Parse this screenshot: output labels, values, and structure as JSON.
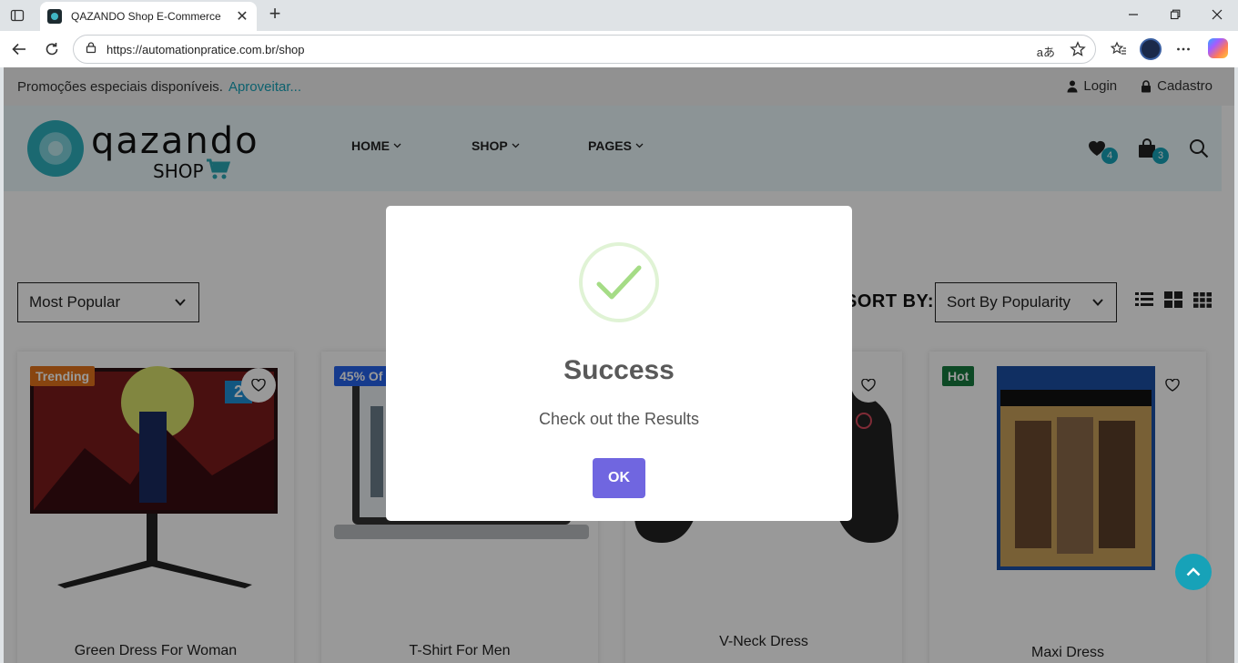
{
  "browser": {
    "tab_title": "QAZANDO Shop E-Commerce",
    "url": "https://automationpratice.com.br/shop",
    "translate_glyph": "aあ"
  },
  "site": {
    "promo_text": "Promoções especiais disponíveis.",
    "promo_link": "Aproveitar...",
    "login_label": "Login",
    "register_label": "Cadastro",
    "logo_text": "QAZANDO",
    "logo_sub": "SHOP",
    "menu": [
      "HOME",
      "SHOP",
      "PAGES"
    ],
    "wishlist_count": "4",
    "cart_count": "3"
  },
  "shop": {
    "filter_value": "Most Popular",
    "sort_label": "SORT BY:",
    "sort_value": "Sort By Popularity",
    "products": [
      {
        "name": "Green Dress For Woman",
        "tag": "Trending",
        "tag_color": "#e3741b",
        "extra_badge": "2"
      },
      {
        "name": "T-Shirt For Men",
        "tag": "45% Of",
        "tag_color": "#2563eb"
      },
      {
        "name": "V-Neck Dress",
        "tag": ""
      },
      {
        "name": "Maxi Dress",
        "tag": "Hot",
        "tag_color": "#167a3f"
      }
    ]
  },
  "modal": {
    "title": "Success",
    "text": "Check out the Results",
    "ok_label": "OK"
  },
  "colors": {
    "accent": "#17a2b8",
    "modal_button": "#7066e0",
    "success_green": "#a5dc86"
  }
}
